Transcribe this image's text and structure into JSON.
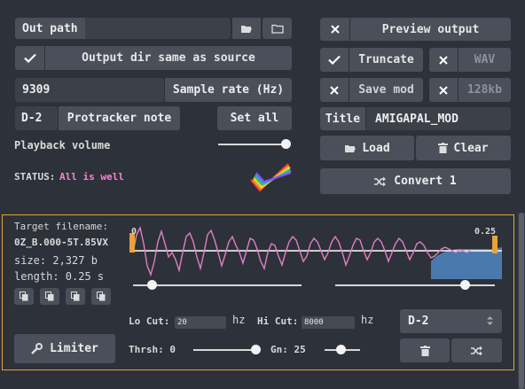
{
  "top_left": {
    "out_path_label": "Out path",
    "same_as_source_label": "Output dir same as source",
    "sample_rate_value": "9309",
    "sample_rate_label": "Sample rate (Hz)",
    "note_value": "D-2",
    "note_label": "Protracker note",
    "set_all_label": "Set all",
    "playback_volume_label": "Playback volume",
    "status_label": "STATUS:",
    "status_text": "All is well"
  },
  "top_right": {
    "preview_label": "Preview output",
    "truncate_label": "Truncate",
    "wav_label": "WAV",
    "save_mod_label": "Save mod",
    "kb_label": "128kb",
    "title_label": "Title",
    "title_value": "AMIGAPAL_MOD",
    "load_label": "Load",
    "clear_label": "Clear",
    "convert_label": "Convert 1"
  },
  "sample_panel": {
    "target_filename_label": "Target filename:",
    "target_filename_value": "0Z_B.000-5T.85VX",
    "size_text": "size: 2,327 b",
    "length_text": "length: 0.25 s",
    "wave_start_label": "0",
    "wave_end_label": "0.25",
    "limiter_label": "Limiter",
    "lo_cut_label": "Lo Cut:",
    "lo_cut_value": "20",
    "lo_cut_unit": "hz",
    "hi_cut_label": "Hi Cut:",
    "hi_cut_value": "8000",
    "hi_cut_unit": "hz",
    "thrsh_label": "Thrsh: 0",
    "gn_label": "Gn: 25",
    "note_select_value": "D-2"
  },
  "colors": {
    "accent": "#e8a33a",
    "status_pink": "#ff7fd6",
    "wave_pink": "#e07fc4",
    "wave_fill": "#4a7aad"
  },
  "levels": {
    "playback_volume": 0.9,
    "wave_left_slider": 0.0,
    "wave_right_slider": 0.8,
    "threshold_slider": 0.0,
    "gain_slider": 0.25
  }
}
